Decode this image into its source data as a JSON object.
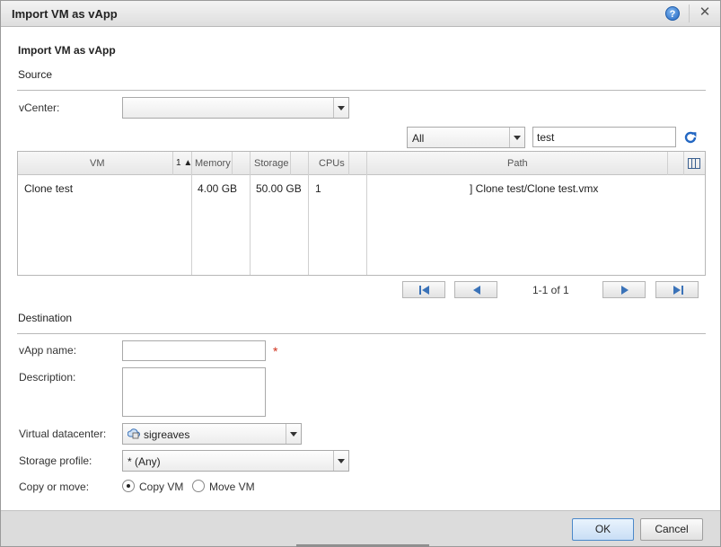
{
  "window": {
    "title": "Import VM as vApp",
    "help_icon": "help-icon",
    "help_glyph": "?",
    "close_icon": "close-icon",
    "close_glyph": "✕"
  },
  "page": {
    "heading": "Import VM as vApp"
  },
  "source": {
    "section_label": "Source",
    "vcenter_label": "vCenter:",
    "vcenter_value": "",
    "filter_value": "All",
    "search_value": "test",
    "refresh_icon": "refresh-icon"
  },
  "grid": {
    "columns": [
      "VM",
      "Memory",
      "Storage",
      "CPUs",
      "Path"
    ],
    "sort_indicator": "1 ▲",
    "columns_icon": "columns-picker-icon",
    "rows": [
      {
        "vm": "Clone test",
        "memory": "4.00 GB",
        "storage": "50.00 GB",
        "cpus": "1",
        "path": "] Clone test/Clone test.vmx"
      }
    ]
  },
  "pager": {
    "text": "1-1 of 1",
    "first_icon": "first-page-icon",
    "prev_icon": "previous-page-icon",
    "next_icon": "next-page-icon",
    "last_icon": "last-page-icon"
  },
  "destination": {
    "section_label": "Destination",
    "vapp_name_label": "vApp name:",
    "vapp_name_value": "",
    "required_marker": "*",
    "description_label": "Description:",
    "datacenter_label": "Virtual datacenter:",
    "datacenter_value": "sigreaves",
    "storage_profile_label": "Storage profile:",
    "storage_profile_value": "* (Any)",
    "copy_move_label": "Copy or move:",
    "copy_option": "Copy VM",
    "move_option": "Move VM",
    "selected_option": "Copy VM"
  },
  "footer": {
    "ok_label": "OK",
    "cancel_label": "Cancel"
  },
  "colors": {
    "accent": "#2367c2",
    "required": "#d0301c",
    "primary_button_border": "#4b88c9"
  }
}
